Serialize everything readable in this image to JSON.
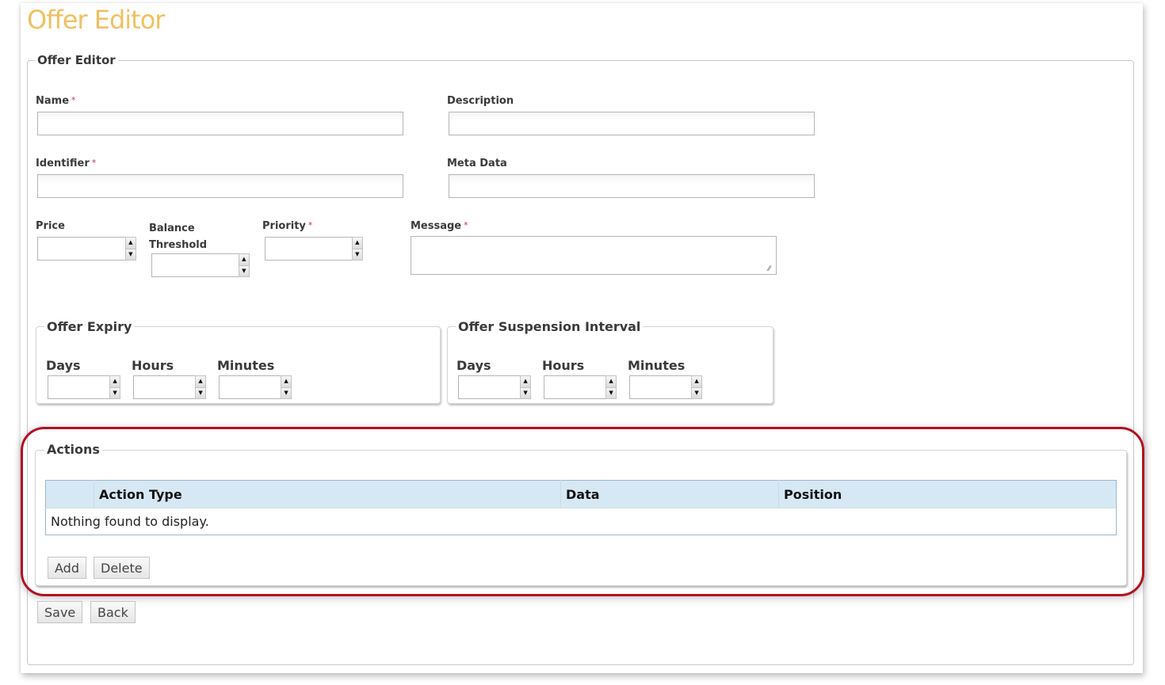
{
  "header": {
    "title": "Offer Editor"
  },
  "form": {
    "legend": "Offer Editor",
    "required_marker": "*",
    "fields": {
      "name": {
        "label": "Name",
        "value": "",
        "required": true
      },
      "description": {
        "label": "Description",
        "value": ""
      },
      "identifier": {
        "label": "Identifier",
        "value": "",
        "required": true
      },
      "meta_data": {
        "label": "Meta Data",
        "value": ""
      },
      "price": {
        "label": "Price",
        "value": ""
      },
      "balance_threshold": {
        "label_line1": "Balance",
        "label_line2": "Threshold",
        "value": ""
      },
      "priority": {
        "label": "Priority",
        "value": "",
        "required": true
      },
      "message": {
        "label": "Message",
        "value": "",
        "required": true
      }
    },
    "offer_expiry": {
      "legend": "Offer Expiry",
      "days_label": "Days",
      "hours_label": "Hours",
      "minutes_label": "Minutes",
      "days": "",
      "hours": "",
      "minutes": ""
    },
    "offer_suspension": {
      "legend": "Offer Suspension Interval",
      "days_label": "Days",
      "hours_label": "Hours",
      "minutes_label": "Minutes",
      "days": "",
      "hours": "",
      "minutes": ""
    },
    "actions": {
      "legend": "Actions",
      "columns": [
        "",
        "Action Type",
        "Data",
        "Position"
      ],
      "empty_message": "Nothing found to display.",
      "add_label": "Add",
      "delete_label": "Delete"
    },
    "save_label": "Save",
    "back_label": "Back"
  },
  "spinner": {
    "up_icon": "▲",
    "down_icon": "▼"
  },
  "resize_icon": "⁄⁄",
  "colors": {
    "title": "#f0c060",
    "highlight": "#b31020",
    "table_header": "#d7e8f5"
  }
}
